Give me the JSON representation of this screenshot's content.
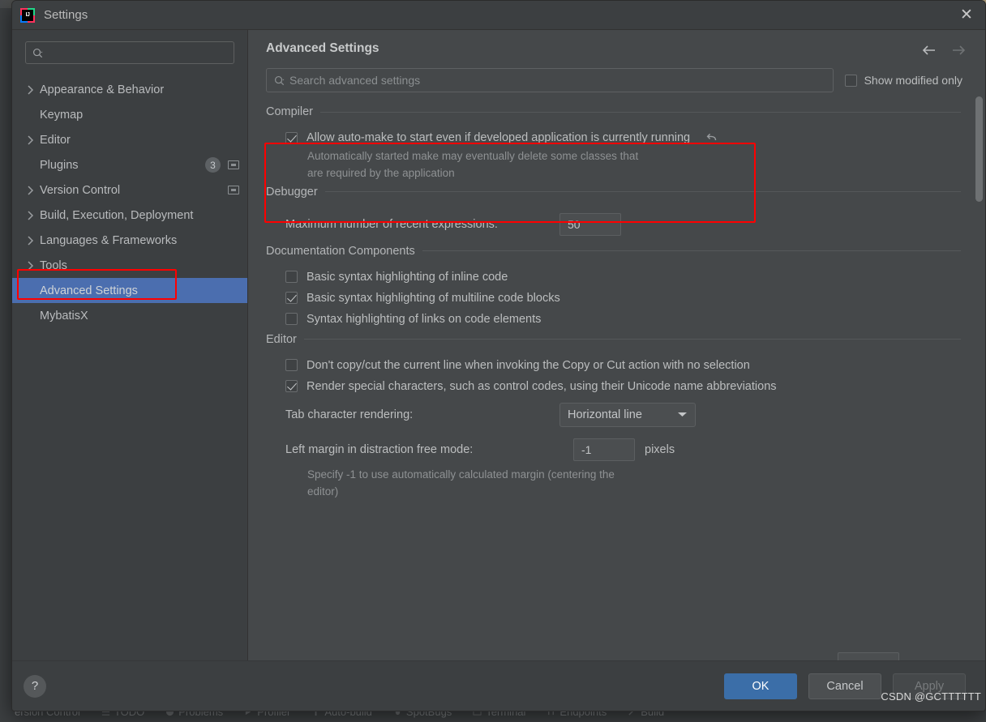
{
  "window": {
    "title": "Settings",
    "app_icon": "intellij-idea-icon",
    "close_icon": "close-icon"
  },
  "sidebar": {
    "search": {
      "placeholder": "",
      "icon": "search-icon"
    },
    "items": [
      {
        "label": "Appearance & Behavior",
        "expandable": true,
        "selected": false,
        "badge": null,
        "project_icon": false
      },
      {
        "label": "Keymap",
        "expandable": false,
        "selected": false,
        "badge": null,
        "project_icon": false
      },
      {
        "label": "Editor",
        "expandable": true,
        "selected": false,
        "badge": null,
        "project_icon": false
      },
      {
        "label": "Plugins",
        "expandable": false,
        "selected": false,
        "badge": "3",
        "project_icon": true
      },
      {
        "label": "Version Control",
        "expandable": true,
        "selected": false,
        "badge": null,
        "project_icon": true
      },
      {
        "label": "Build, Execution, Deployment",
        "expandable": true,
        "selected": false,
        "badge": null,
        "project_icon": false
      },
      {
        "label": "Languages & Frameworks",
        "expandable": true,
        "selected": false,
        "badge": null,
        "project_icon": false
      },
      {
        "label": "Tools",
        "expandable": true,
        "selected": false,
        "badge": null,
        "project_icon": false
      },
      {
        "label": "Advanced Settings",
        "expandable": false,
        "selected": true,
        "badge": null,
        "project_icon": false
      },
      {
        "label": "MybatisX",
        "expandable": false,
        "selected": false,
        "badge": null,
        "project_icon": false
      }
    ]
  },
  "content": {
    "page_title": "Advanced Settings",
    "nav_back_icon": "arrow-left-icon",
    "nav_forward_icon": "arrow-right-icon",
    "search": {
      "placeholder": "Search advanced settings",
      "value": "",
      "icon": "search-icon"
    },
    "show_modified_only": {
      "label": "Show modified only",
      "checked": false
    },
    "sections": [
      {
        "title": "Compiler",
        "options": [
          {
            "type": "checkbox",
            "label": "Allow auto-make to start even if developed application is currently running",
            "checked": true,
            "revert_icon": "revert-icon",
            "description": "Automatically started make may eventually delete some classes that are required by the application"
          }
        ]
      },
      {
        "title": "Debugger",
        "options": [
          {
            "type": "number",
            "label": "Maximum number of recent expressions:",
            "value": "50"
          }
        ]
      },
      {
        "title": "Documentation Components",
        "options": [
          {
            "type": "checkbox",
            "label": "Basic syntax highlighting of inline code",
            "checked": false
          },
          {
            "type": "checkbox",
            "label": "Basic syntax highlighting of multiline code blocks",
            "checked": true
          },
          {
            "type": "checkbox",
            "label": "Syntax highlighting of links on code elements",
            "checked": false
          }
        ]
      },
      {
        "title": "Editor",
        "options": [
          {
            "type": "checkbox",
            "label": "Don't copy/cut the current line when invoking the Copy or Cut action with no selection",
            "checked": false
          },
          {
            "type": "checkbox",
            "label": "Render special characters, such as control codes, using their Unicode name abbreviations",
            "checked": true
          },
          {
            "type": "combo",
            "label": "Tab character rendering:",
            "value": "Horizontal line",
            "caret_icon": "chevron-down-icon"
          },
          {
            "type": "number",
            "label": "Left margin in distraction free mode:",
            "value": "-1",
            "unit": "pixels",
            "description": "Specify -1 to use automatically calculated margin (centering the editor)"
          }
        ]
      }
    ]
  },
  "footer": {
    "help_label": "?",
    "ok_label": "OK",
    "cancel_label": "Cancel",
    "apply_label": "Apply",
    "apply_disabled": true
  },
  "background": {
    "statusbar_items": [
      {
        "label": "ersion Control",
        "icon": "branch-icon"
      },
      {
        "label": "TODO",
        "icon": "list-icon"
      },
      {
        "label": "Problems",
        "icon": "warning-icon"
      },
      {
        "label": "Profiler",
        "icon": "profiler-icon"
      },
      {
        "label": "Auto-build",
        "icon": "hammer-icon"
      },
      {
        "label": "SpotBugs",
        "icon": "bug-icon"
      },
      {
        "label": "Terminal",
        "icon": "terminal-icon"
      },
      {
        "label": "Endpoints",
        "icon": "endpoints-icon"
      },
      {
        "label": "Build",
        "icon": "build-icon"
      }
    ]
  },
  "watermark": "CSDN @GCTTTTTT",
  "colors": {
    "accent_blue": "#3b6ea8",
    "selection_blue": "#4b6eaf",
    "annotation_red": "#ff0000",
    "dialog_bg": "#3c3f41",
    "content_bg": "#45484a"
  }
}
